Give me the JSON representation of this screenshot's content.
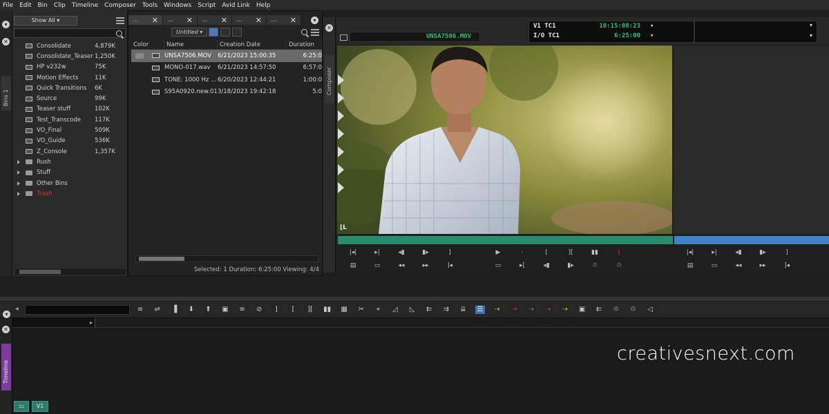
{
  "menu": [
    "File",
    "Edit",
    "Bin",
    "Clip",
    "Timeline",
    "Composer",
    "Tools",
    "Windows",
    "Script",
    "Avid Link",
    "Help"
  ],
  "bins_panel": {
    "tab_label": "Bins 1",
    "show_all": "Show All",
    "bins": [
      {
        "name": "Consolidate",
        "size": "4,879K",
        "kind": "bin"
      },
      {
        "name": "Consolidate_Teaser",
        "size": "1,250K",
        "kind": "bin"
      },
      {
        "name": "HP v232w",
        "size": "75K",
        "kind": "bin"
      },
      {
        "name": "Motion Effects",
        "size": "11K",
        "kind": "bin"
      },
      {
        "name": "Quick Transitions",
        "size": "6K",
        "kind": "bin"
      },
      {
        "name": "Source",
        "size": "99K",
        "kind": "bin"
      },
      {
        "name": "Teaser stuff",
        "size": "102K",
        "kind": "bin"
      },
      {
        "name": "Test_Transcode",
        "size": "117K",
        "kind": "bin"
      },
      {
        "name": "VO_Final",
        "size": "509K",
        "kind": "bin"
      },
      {
        "name": "VO_Guide",
        "size": "536K",
        "kind": "bin"
      },
      {
        "name": "Z_Console",
        "size": "1,357K",
        "kind": "bin"
      },
      {
        "name": "Rush",
        "size": "",
        "kind": "folder"
      },
      {
        "name": "Stuff",
        "size": "",
        "kind": "folder"
      },
      {
        "name": "Other Bins",
        "size": "",
        "kind": "folder"
      },
      {
        "name": "Trash",
        "size": "",
        "kind": "trash"
      }
    ]
  },
  "bin_window": {
    "tabs": [
      "...",
      "...",
      "...",
      "...",
      "..."
    ],
    "view_select": "Untitled",
    "columns": [
      "Color",
      "Name",
      "Creation Date",
      "Duration"
    ],
    "clips": [
      {
        "name": "UNSA7506.MOV",
        "date": "6/21/2023 15:00:35",
        "duration": "6:25:0",
        "selected": true
      },
      {
        "name": "MONO-017.wav",
        "date": "6/21/2023 14:57:50",
        "duration": "6:57:0",
        "selected": false
      },
      {
        "name": "TONE: 1000 Hz ...",
        "date": "6/20/2023 12:44:21",
        "duration": "1:00:0",
        "selected": false
      },
      {
        "name": "S95A0920.new.01",
        "date": "3/18/2023 19:42:18",
        "duration": "5:0",
        "selected": false
      }
    ],
    "status": "Selected: 1  Duration: 6:25:00  Viewing: 4/4"
  },
  "composer": {
    "tab_label": "Composer",
    "clip_name": "UNSA7506.MOV",
    "timecodes": [
      {
        "label": "V1  TC1",
        "value": "10:15:08:23"
      },
      {
        "label": "I/O  TC1",
        "value": "6:25:00"
      }
    ]
  },
  "timeline": {
    "tab_label": "Timeline",
    "tracks": [
      "",
      "V1"
    ]
  },
  "watermark": "creativesnext.com",
  "colors": {
    "timecode_green": "#31c07a",
    "position_bar": "#2a8c6e",
    "record_bar": "#3f82c8",
    "timeline_tab": "#7a3d9b",
    "trash_red": "#e03030"
  }
}
